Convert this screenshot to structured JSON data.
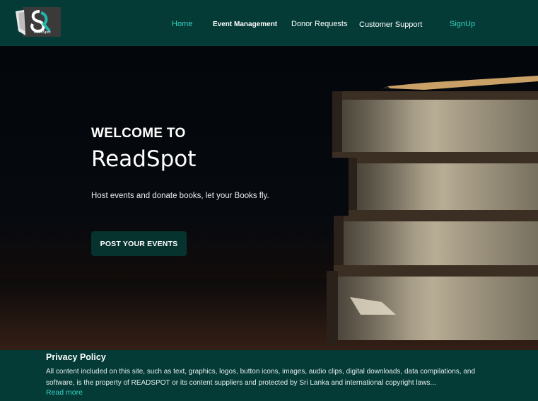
{
  "header": {
    "logo_text": "ReadSpot",
    "nav": {
      "home": "Home",
      "event_management": "Event Management",
      "donor_requests": "Donor Requests",
      "customer_support": "Customer Support",
      "signup": "SignUp"
    }
  },
  "hero": {
    "welcome": "WELCOME TO",
    "brand": "ReadSpot",
    "tagline": "Host events and donate books, let your Books fly.",
    "cta_label": "POST YOUR EVENTS"
  },
  "footer": {
    "title": "Privacy Policy",
    "text": "All content included on this site, such as text, graphics, logos, button icons, images, audio clips, digital downloads, data compilations, and software, is the property of READSPOT or its content suppliers and protected by Sri Lanka and international copyright laws...",
    "read_more": "Read more"
  },
  "colors": {
    "header_bg": "#043b37",
    "accent": "#36d1c4",
    "cta_bg": "#07332f"
  }
}
